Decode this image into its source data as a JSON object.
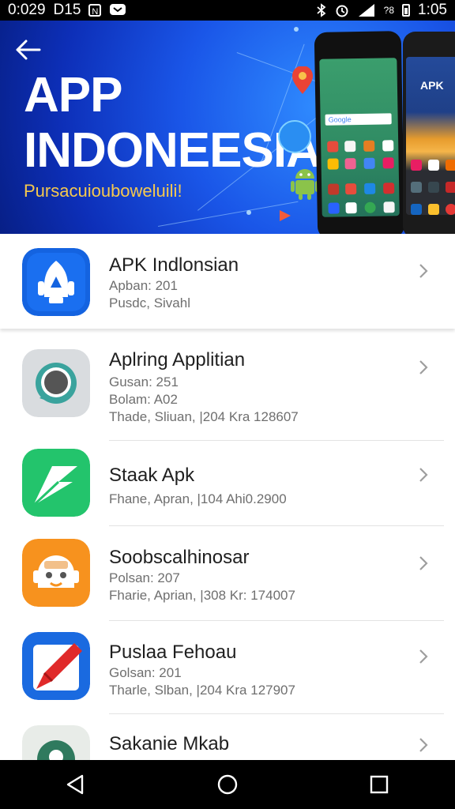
{
  "status_bar": {
    "left_time": "0:029",
    "left_label": "D15",
    "left_box": "N",
    "signal_text": "?8",
    "clock": "1:05",
    "icons": [
      "bluetooth-icon",
      "alarm-icon",
      "wifi-icon",
      "signal-icon",
      "battery-icon"
    ]
  },
  "banner": {
    "title_line1": "APP",
    "title_line2": "INDONEESIA",
    "subtitle": "Pursacuiouboweluili!",
    "search_bar_label": "Google",
    "phone_brand": "APK",
    "colors": {
      "bg": "#1a56e8",
      "subtitle": "#f6c94e"
    }
  },
  "apps": [
    {
      "name": "APK Indlonsian",
      "line1": "Apban: 201",
      "line2": "Pusdc, Sivahl",
      "line3": "",
      "icon": "robot-icon",
      "icon_color": "#1463e0"
    },
    {
      "name": "Aplring Applitian",
      "line1": "Gusan: 251",
      "line2": "Bolam: A02",
      "line3": "Thade, Sliuan, |204 Kra 128607",
      "icon": "chat-bubble-icon",
      "icon_color": "#d9dcdf"
    },
    {
      "name": "Staak Apk",
      "line1": "Fhane, Apran, |104 Ahi0.2900",
      "line2": "",
      "line3": "",
      "icon": "arrow-icon",
      "icon_color": "#23c46c"
    },
    {
      "name": "Soobscalhinosar",
      "line1": "Polsan: 207",
      "line2": "Fharie, Aprian, |308 Kr: 174007",
      "line3": "",
      "icon": "droid-face-icon",
      "icon_color": "#f7921e"
    },
    {
      "name": "Puslaa Fehoau",
      "line1": "Golsan: 201",
      "line2": "Tharle, Slban, |204 Kra 127907",
      "line3": "",
      "icon": "pen-icon",
      "icon_color": "#1a6ae0"
    },
    {
      "name": "Sakanie Mkab",
      "line1": "",
      "line2": "",
      "line3": "",
      "icon": "location-icon",
      "icon_color": "#e8ece8"
    }
  ],
  "nav": {
    "back": "back-icon",
    "home": "home-icon",
    "recents": "recents-icon"
  }
}
